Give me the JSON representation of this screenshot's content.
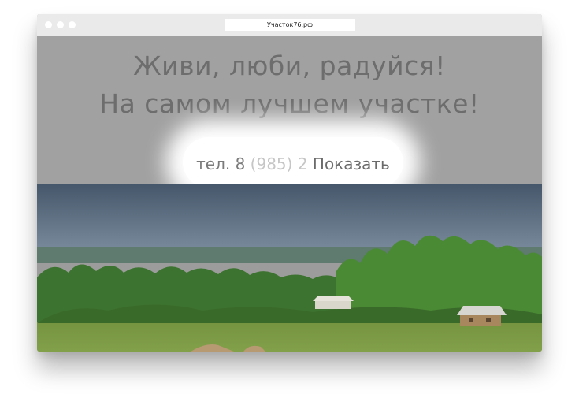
{
  "browser": {
    "address": "Участок76.рф"
  },
  "hero": {
    "headline_line1": "Живи, люби, радуйся!",
    "headline_line2": "На самом лучшем участке!",
    "phone_prefix": "тел. 8",
    "phone_hidden": "(985) 2",
    "show_button": "Показать"
  },
  "colors": {
    "hero_background": "#a1a1a1",
    "headline": "#6d6d6d",
    "sky": "#4a5a6c",
    "grass": "#6f8e3c",
    "forest": "#3f7a2c"
  }
}
